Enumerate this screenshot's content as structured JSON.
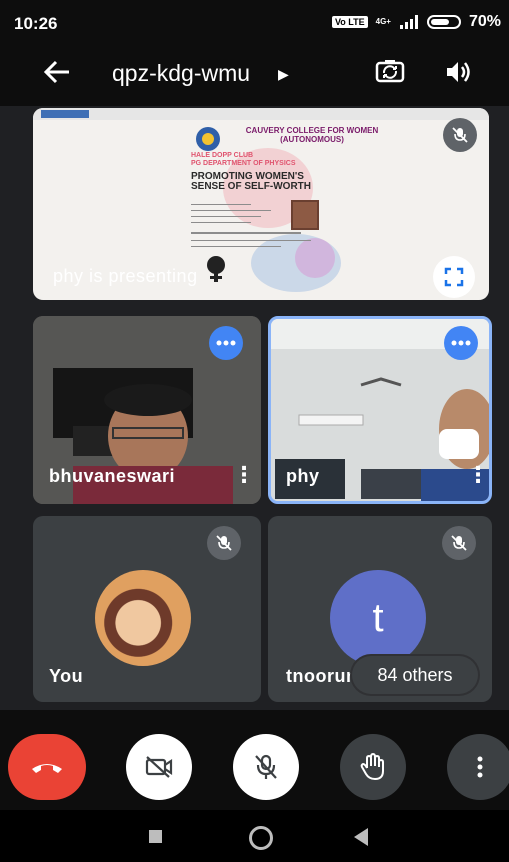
{
  "status": {
    "time": "10:26",
    "volte": "Vo LTE",
    "network": "4G+",
    "battery_text": "70%",
    "battery_level": 0.7
  },
  "header": {
    "meeting_code": "qpz-kdg-wmu"
  },
  "presentation": {
    "label": "phy is presenting",
    "slide_college": "CAUVERY COLLEGE FOR WOMEN (AUTONOMOUS)",
    "slide_club": "HALE DOPP CLUB",
    "slide_dept": "PG DEPARTMENT OF PHYSICS",
    "slide_heading": "PROMOTING WOMEN'S SENSE OF SELF-WORTH"
  },
  "participants": {
    "tile1_name": "bhuvaneswari",
    "tile2_name": "phy",
    "tile3_name": "You",
    "tile4_name": "tnoorun",
    "tile4_initial": "t",
    "others_text": "84 others"
  },
  "colors": {
    "accent": "#4285f4",
    "end_call": "#ea4335",
    "tile_bg": "#3c4043",
    "active_border": "#8ab4f8"
  },
  "icons": {
    "back": "back-arrow-icon",
    "switch_camera": "switch-camera-icon",
    "speaker": "speaker-icon",
    "mic_off": "mic-off-icon",
    "more": "more-dots-icon",
    "fullscreen": "fullscreen-icon",
    "end_call": "phone-hangup-icon",
    "camera_off": "camera-off-icon",
    "raise_hand": "raise-hand-icon"
  }
}
